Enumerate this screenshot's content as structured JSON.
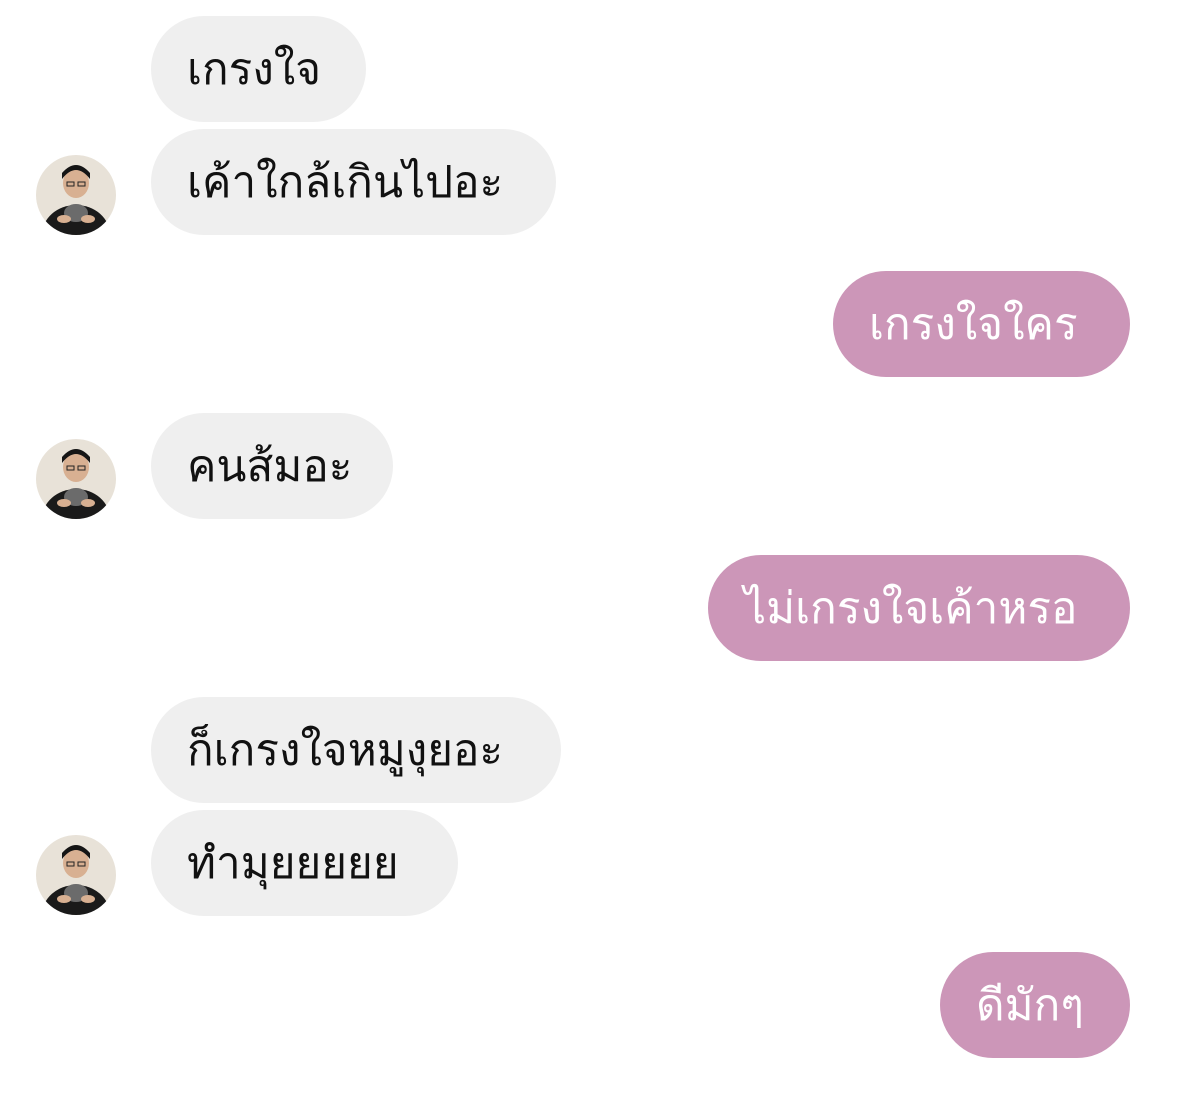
{
  "chat": {
    "messages": [
      {
        "sender": "them",
        "text": "เกรงใจ"
      },
      {
        "sender": "them",
        "text": "เค้าใกล้เกินไปอะ",
        "avatar": "user-avatar"
      },
      {
        "sender": "me",
        "text": "เกรงใจใคร"
      },
      {
        "sender": "them",
        "text": "คนส้มอะ",
        "avatar": "user-avatar"
      },
      {
        "sender": "me",
        "text": "ไม่เกรงใจเค้าหรอ"
      },
      {
        "sender": "them",
        "text": "ก็เกรงใจหมูงุยอะ"
      },
      {
        "sender": "them",
        "text": "ทำมุยยยยย",
        "avatar": "user-avatar"
      },
      {
        "sender": "me",
        "text": "ดีมักๆ"
      }
    ]
  },
  "colors": {
    "incoming_bubble": "#efefef",
    "outgoing_bubble": "#cc96b8",
    "incoming_text": "#111111",
    "outgoing_text": "#ffffff"
  }
}
